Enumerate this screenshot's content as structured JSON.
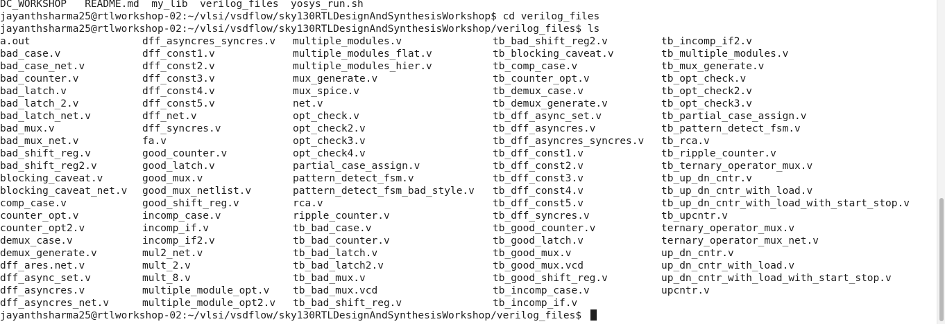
{
  "terminal": {
    "top_line": "DC_WORKSHOP   README.md  my_lib  verilog_files  yosys_run.sh",
    "prompt_cd": "jayanthsharma25@rtlworkshop-02:~/vlsi/vsdflow/sky130RTLDesignAndSynthesisWorkshop$ cd verilog_files",
    "prompt_ls": "jayanthsharma25@rtlworkshop-02:~/vlsi/vsdflow/sky130RTLDesignAndSynthesisWorkshop/verilog_files$ ls",
    "prompt_final": "jayanthsharma25@rtlworkshop-02:~/vlsi/vsdflow/sky130RTLDesignAndSynthesisWorkshop/verilog_files$ ",
    "ls_rows": [
      [
        "a.out",
        "dff_asyncres_syncres.v",
        "multiple_modules.v",
        "tb_bad_shift_reg2.v",
        "tb_incomp_if2.v"
      ],
      [
        "bad_case.v",
        "dff_const1.v",
        "multiple_modules_flat.v",
        "tb_blocking_caveat.v",
        "tb_multiple_modules.v"
      ],
      [
        "bad_case_net.v",
        "dff_const2.v",
        "multiple_modules_hier.v",
        "tb_comp_case.v",
        "tb_mux_generate.v"
      ],
      [
        "bad_counter.v",
        "dff_const3.v",
        "mux_generate.v",
        "tb_counter_opt.v",
        "tb_opt_check.v"
      ],
      [
        "bad_latch.v",
        "dff_const4.v",
        "mux_spice.v",
        "tb_demux_case.v",
        "tb_opt_check2.v"
      ],
      [
        "bad_latch_2.v",
        "dff_const5.v",
        "net.v",
        "tb_demux_generate.v",
        "tb_opt_check3.v"
      ],
      [
        "bad_latch_net.v",
        "dff_net.v",
        "opt_check.v",
        "tb_dff_async_set.v",
        "tb_partial_case_assign.v"
      ],
      [
        "bad_mux.v",
        "dff_syncres.v",
        "opt_check2.v",
        "tb_dff_asyncres.v",
        "tb_pattern_detect_fsm.v"
      ],
      [
        "bad_mux_net.v",
        "fa.v",
        "opt_check3.v",
        "tb_dff_asyncres_syncres.v",
        "tb_rca.v"
      ],
      [
        "bad_shift_reg.v",
        "good_counter.v",
        "opt_check4.v",
        "tb_dff_const1.v",
        "tb_ripple_counter.v"
      ],
      [
        "bad_shift_reg2.v",
        "good_latch.v",
        "partial_case_assign.v",
        "tb_dff_const2.v",
        "tb_ternary_operator_mux.v"
      ],
      [
        "blocking_caveat.v",
        "good_mux.v",
        "pattern_detect_fsm.v",
        "tb_dff_const3.v",
        "tb_up_dn_cntr.v"
      ],
      [
        "blocking_caveat_net.v",
        "good_mux_netlist.v",
        "pattern_detect_fsm_bad_style.v",
        "tb_dff_const4.v",
        "tb_up_dn_cntr_with_load.v"
      ],
      [
        "comp_case.v",
        "good_shift_reg.v",
        "rca.v",
        "tb_dff_const5.v",
        "tb_up_dn_cntr_with_load_with_start_stop.v"
      ],
      [
        "counter_opt.v",
        "incomp_case.v",
        "ripple_counter.v",
        "tb_dff_syncres.v",
        "tb_upcntr.v"
      ],
      [
        "counter_opt2.v",
        "incomp_if.v",
        "tb_bad_case.v",
        "tb_good_counter.v",
        "ternary_operator_mux.v"
      ],
      [
        "demux_case.v",
        "incomp_if2.v",
        "tb_bad_counter.v",
        "tb_good_latch.v",
        "ternary_operator_mux_net.v"
      ],
      [
        "demux_generate.v",
        "mul2_net.v",
        "tb_bad_latch.v",
        "tb_good_mux.v",
        "up_dn_cntr.v"
      ],
      [
        "dff_ares.net.v",
        "mult_2.v",
        "tb_bad_latch2.v",
        "tb_good_mux.vcd",
        "up_dn_cntr_with_load.v"
      ],
      [
        "dff_async_set.v",
        "mult_8.v",
        "tb_bad_mux.v",
        "tb_good_shift_reg.v",
        "up_dn_cntr_with_load_with_start_stop.v"
      ],
      [
        "dff_asyncres.v",
        "multiple_module_opt.v",
        "tb_bad_mux.vcd",
        "tb_incomp_case.v",
        "upcntr.v"
      ],
      [
        "dff_asyncres_net.v",
        "multiple_module_opt2.v",
        "tb_bad_shift_reg.v",
        "tb_incomp_if.v",
        ""
      ]
    ]
  }
}
